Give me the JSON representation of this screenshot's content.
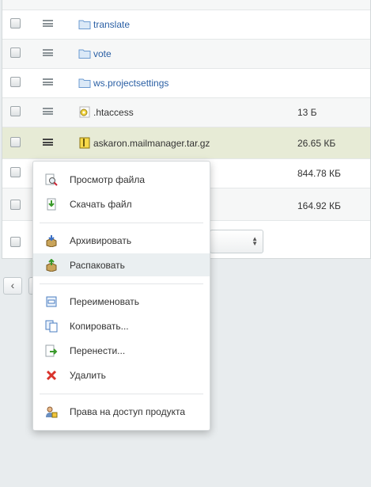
{
  "files": [
    {
      "name": "",
      "size": "",
      "type": "folder"
    },
    {
      "name": "translate",
      "size": "",
      "type": "folder"
    },
    {
      "name": "vote",
      "size": "",
      "type": "folder"
    },
    {
      "name": "ws.projectsettings",
      "size": "",
      "type": "folder"
    },
    {
      "name": ".htaccess",
      "size": "13 Б",
      "type": "config"
    },
    {
      "name": "askaron.mailmanager.tar.gz",
      "size": "26.65 КБ",
      "type": "archive",
      "selected": true
    },
    {
      "name": "",
      "size": "844.78 КБ",
      "type": "file"
    },
    {
      "name": "",
      "size": "164.92 КБ",
      "type": "file"
    }
  ],
  "footer": {
    "select_value": ""
  },
  "pager": {
    "prev_label": "‹"
  },
  "context_menu": {
    "items": [
      {
        "label": "Просмотр файла",
        "icon": "view-file-icon"
      },
      {
        "label": "Скачать файл",
        "icon": "download-icon"
      },
      {
        "label": "Архивировать",
        "icon": "archive-icon"
      },
      {
        "label": "Распаковать",
        "icon": "unpack-icon"
      },
      {
        "label": "Переименовать",
        "icon": "rename-icon"
      },
      {
        "label": "Копировать...",
        "icon": "copy-icon"
      },
      {
        "label": "Перенести...",
        "icon": "move-icon"
      },
      {
        "label": "Удалить",
        "icon": "delete-icon"
      },
      {
        "label": "Права на доступ продукта",
        "icon": "permissions-icon"
      }
    ],
    "hovered": "Распаковать"
  },
  "colors": {
    "link": "#2a5fa4",
    "selected_row": "#e7ebd6",
    "menu_hover": "#eaeff1",
    "delete": "#d9332b"
  }
}
